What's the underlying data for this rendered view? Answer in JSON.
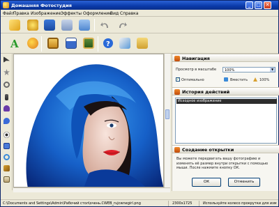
{
  "window": {
    "title": "Домашняя Фотостудия",
    "minimize": "_",
    "maximize": "□",
    "close": "✕"
  },
  "menu": [
    "Файл",
    "Правка",
    "Изображение",
    "Эффекты",
    "Оформление",
    "Вид",
    "Справка"
  ],
  "toolbar1": {
    "icons": [
      "open-folder-icon",
      "save-export-icon",
      "save-disk-icon",
      "print-icon",
      "scan-icon",
      "undo-icon",
      "redo-icon"
    ]
  },
  "toolbar2": {
    "icons": [
      "text-tool-icon",
      "palette-icon",
      "image-frame-icon",
      "calendar-icon",
      "photo-collage-icon",
      "help-icon",
      "cube-icon",
      "package-icon"
    ]
  },
  "left_tools": [
    "pointer-icon",
    "star-icon",
    "magnifier-icon",
    "crop-icon",
    "brush-icon",
    "eyedropper-icon",
    "eye-icon",
    "rect-select-icon",
    "lasso-icon",
    "clone-icon",
    "fill-icon"
  ],
  "navigation": {
    "header": "Навигация",
    "zoom_label": "Просмотр в масштабе",
    "zoom_value": "100%",
    "fit_label": "Оптимально",
    "fit_checked": true,
    "fit_button": "Вместить",
    "actual_button": "100%"
  },
  "history": {
    "header": "История действий",
    "items": [
      "Исходное изображение"
    ]
  },
  "postcard": {
    "header": "Создание открытки",
    "text": "Вы можете передвигать вашу фотографию и изменять её размер внутри открытки с помощью мыши. После нажмите кнопку ОК.",
    "ok": "ОК",
    "cancel": "Отменить"
  },
  "status": {
    "path": "C:\\Documents and Settings\\Admin\\Рабочий стол\\очень.CWEB_rujcwnegirl.png",
    "size": "2300x1725",
    "hint": "Используйте колесо прокрутки для изм"
  }
}
